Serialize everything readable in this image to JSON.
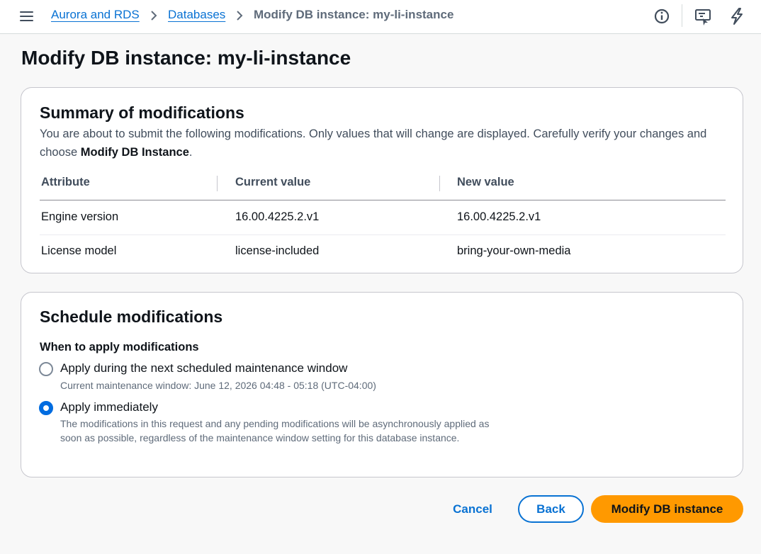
{
  "breadcrumb": {
    "items": [
      {
        "label": "Aurora and RDS"
      },
      {
        "label": "Databases"
      }
    ],
    "current": "Modify DB instance: my-li-instance"
  },
  "top_icons": [
    "info-icon",
    "feedback-icon",
    "lightning-icon"
  ],
  "page": {
    "title": "Modify DB instance: my-li-instance"
  },
  "summary": {
    "title": "Summary of modifications",
    "description_prefix": "You are about to submit the following modifications. Only values that will change are displayed. Carefully verify your changes and choose ",
    "description_bold": "Modify DB Instance",
    "description_suffix": ".",
    "columns": [
      "Attribute",
      "Current value",
      "New value"
    ],
    "rows": [
      [
        "Engine version",
        "16.00.4225.2.v1",
        "16.00.4225.2.v1"
      ],
      [
        "License model",
        "license-included",
        "bring-your-own-media"
      ]
    ]
  },
  "schedule": {
    "title": "Schedule modifications",
    "question": "When to apply modifications",
    "options": [
      {
        "label": "Apply during the next scheduled maintenance window",
        "description": "Current maintenance window: June 12, 2026 04:48 - 05:18 (UTC-04:00)",
        "selected": false
      },
      {
        "label": "Apply immediately",
        "description": "The modifications in this request and any pending modifications will be asynchronously applied as soon as possible, regardless of the maintenance window setting for this database instance.",
        "selected": true
      }
    ]
  },
  "actions": {
    "cancel": "Cancel",
    "back": "Back",
    "submit": "Modify DB instance"
  },
  "colors": {
    "link": "#0972d3",
    "primary_button": "#ff9900",
    "radio_selected": "#006ce0"
  }
}
